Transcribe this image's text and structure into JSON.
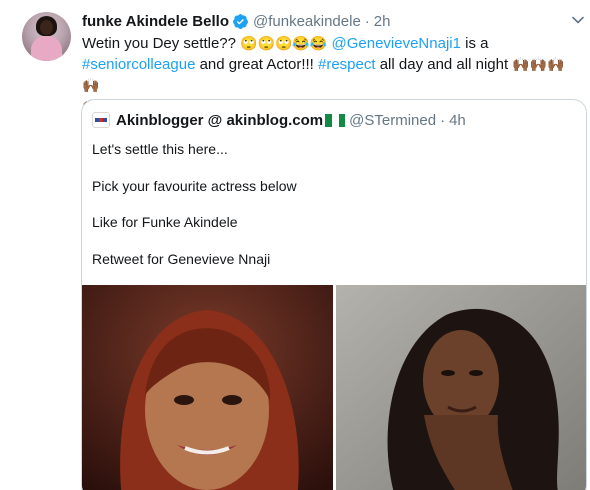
{
  "tweet": {
    "display_name": "funke Akindele Bello",
    "handle": "@funkeakindele",
    "separator": "·",
    "time": "2h",
    "text_part1": "Wetin you Dey settle?? ",
    "emojis1": "🙄🙄🙄😂😂",
    "mention": "@GenevieveNnaji1",
    "text_part2": " is a ",
    "hashtag1": "#seniorcolleague",
    "text_part3": " and great Actor!!! ",
    "hashtag2": "#respect",
    "text_part4": " all day and all night ",
    "emojis2": "🙌🏾🙌🏾🙌🏾🙌🏾",
    "emojis3": "🙌🏾"
  },
  "quoted": {
    "name": "Akinblogger @ akinblog.com",
    "handle": "@STermined",
    "separator": "·",
    "time": "4h",
    "lines": [
      "Let's settle this here...",
      "Pick your favourite actress below",
      "Like for Funke Akindele",
      "Retweet for Genevieve Nnaji"
    ]
  },
  "icons": {
    "verified": "verified-badge-icon",
    "caret": "chevron-down-icon",
    "flag": "nigeria-flag-icon"
  },
  "colors": {
    "link": "#1da1f2",
    "muted": "#657786",
    "verified": "#1da1f2",
    "border": "#ccd6dd"
  }
}
